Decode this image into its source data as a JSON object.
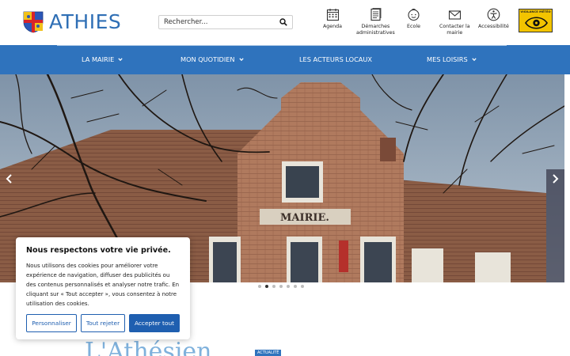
{
  "site": {
    "name": "ATHIES"
  },
  "search": {
    "placeholder": "Rechercher..."
  },
  "quicklinks": [
    {
      "label_1": "Agenda",
      "label_2": "",
      "icon": "calendar-icon"
    },
    {
      "label_1": "Démarches",
      "label_2": "administratives",
      "icon": "document-icon"
    },
    {
      "label_1": "Ecole",
      "label_2": "",
      "icon": "child-face-icon"
    },
    {
      "label_1": "Contacter la",
      "label_2": "mairie",
      "icon": "envelope-icon"
    },
    {
      "label_1": "Accessibilité",
      "label_2": "",
      "icon": "accessibility-icon"
    }
  ],
  "vigilance": {
    "text": "VIGILANCE MÉTÉO"
  },
  "nav": [
    {
      "label": "LA MAIRIE",
      "has_menu": true
    },
    {
      "label": "MON QUOTIDIEN",
      "has_menu": true
    },
    {
      "label": "LES ACTEURS LOCAUX",
      "has_menu": false
    },
    {
      "label": "MES LOISIRS",
      "has_menu": true
    }
  ],
  "slider": {
    "building_sign": "MAIRIE.",
    "slide_count": 7,
    "active_slide": 2
  },
  "cookie": {
    "title": "Nous respectons votre vie privée.",
    "body": "Nous utilisons des cookies pour améliorer votre expérience de navigation, diffuser des publicités ou des contenus personnalisés et analyser notre trafic. En cliquant sur « Tout accepter », vous consentez à notre utilisation des cookies.",
    "customize": "Personnaliser",
    "reject": "Tout rejeter",
    "accept": "Accepter tout"
  },
  "news": {
    "title": "L'Athésien",
    "badge": "ACTUALITÉ"
  },
  "colors": {
    "brand_blue": "#2f73bd",
    "logo_blue": "#2f6fb5",
    "vigilance_yellow": "#f3c400"
  }
}
